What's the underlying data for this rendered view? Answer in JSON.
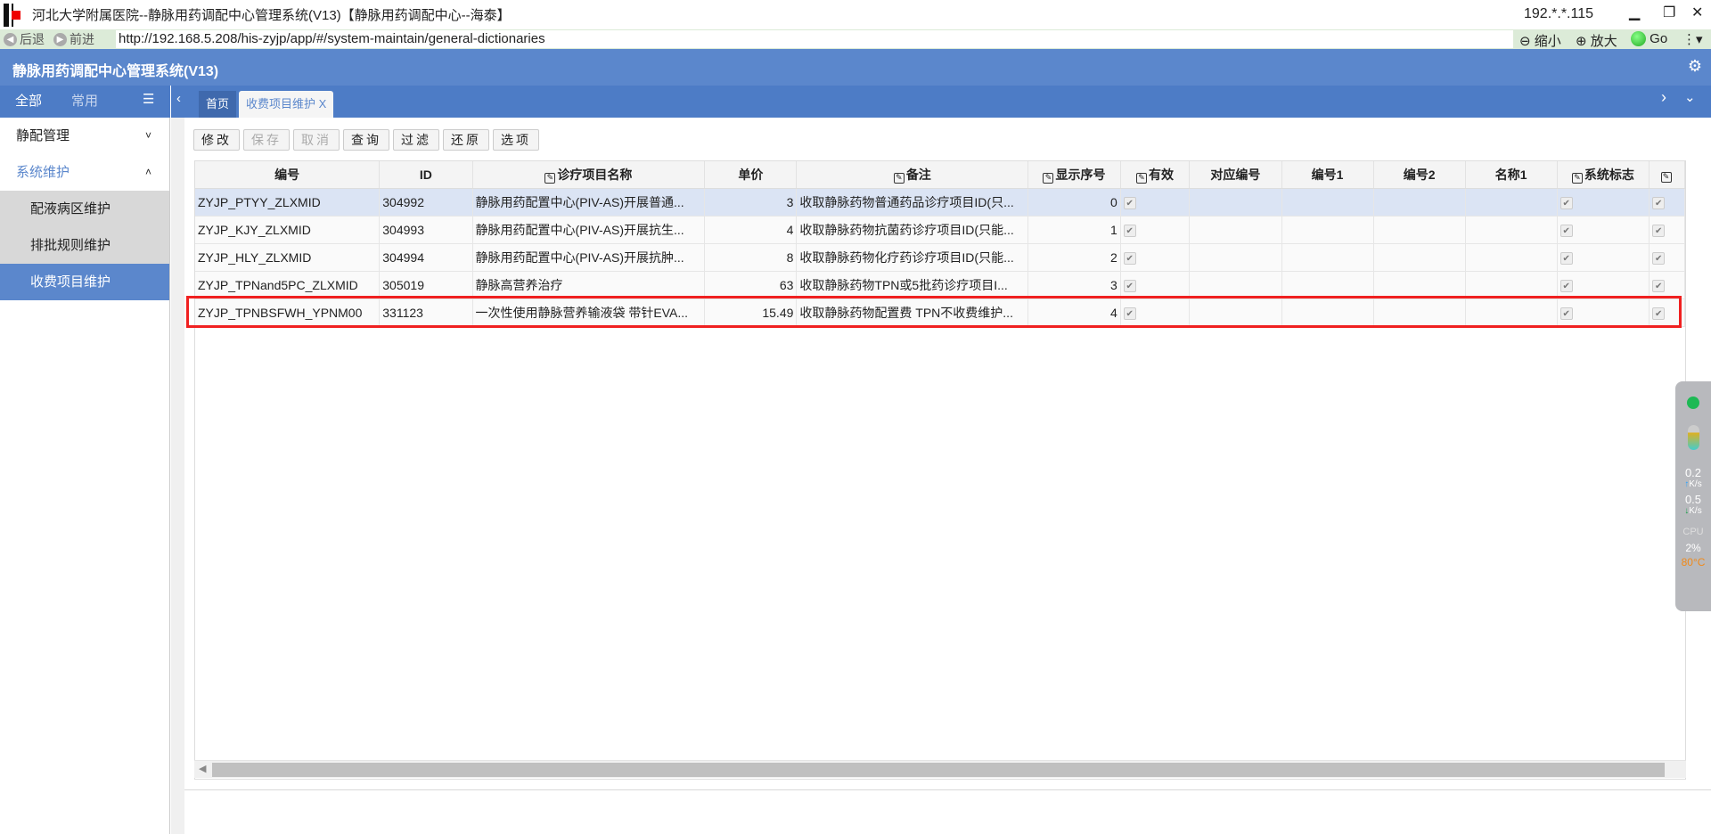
{
  "window": {
    "title": "河北大学附属医院--静脉用药调配中心管理系统(V13)【静脉用药调配中心--海泰】",
    "ip": "192.*.*.115"
  },
  "browser": {
    "back": "后退",
    "forward": "前进",
    "url": "http://192.168.5.208/his-zyjp/app/#/system-maintain/general-dictionaries",
    "zoom_out": "缩小",
    "zoom_in": "放大",
    "go": "Go"
  },
  "app": {
    "title": "静脉用药调配中心管理系统(V13)"
  },
  "sidebar": {
    "tabs": [
      "全部",
      "常用"
    ],
    "items": [
      {
        "label": "静配管理",
        "chev": "˅"
      },
      {
        "label": "系统维护",
        "chev": "˄"
      },
      {
        "label": "配液病区维护"
      },
      {
        "label": "排批规则维护"
      },
      {
        "label": "收费项目维护"
      }
    ]
  },
  "tabs": [
    {
      "label": "首页"
    },
    {
      "label": "收费项目维护",
      "close": "X"
    }
  ],
  "toolbar": [
    "修改",
    "保存",
    "取消",
    "查询",
    "过滤",
    "还原",
    "选项"
  ],
  "table": {
    "columns": [
      "编号",
      "ID",
      "诊疗项目名称",
      "单价",
      "备注",
      "显示序号",
      "有效",
      "对应编号",
      "编号1",
      "编号2",
      "名称1",
      "系统标志",
      ""
    ],
    "rows": [
      [
        "ZYJP_PTYY_ZLXMID",
        "304992",
        "静脉用药配置中心(PIV-AS)开展普通...",
        "3",
        "收取静脉药物普通药品诊疗项目ID(只...",
        "0"
      ],
      [
        "ZYJP_KJY_ZLXMID",
        "304993",
        "静脉用药配置中心(PIV-AS)开展抗生...",
        "4",
        "收取静脉药物抗菌药诊疗项目ID(只能...",
        "1"
      ],
      [
        "ZYJP_HLY_ZLXMID",
        "304994",
        "静脉用药配置中心(PIV-AS)开展抗肿...",
        "8",
        "收取静脉药物化疗药诊疗项目ID(只能...",
        "2"
      ],
      [
        "ZYJP_TPNand5PC_ZLXMID",
        "305019",
        "静脉高营养治疗",
        "63",
        "收取静脉药物TPN或5批药诊疗项目I...",
        "3"
      ],
      [
        "ZYJP_TPNBSFWH_YPNM00",
        "331123",
        "一次性使用静脉营养输液袋 带针EVA...",
        "15.49",
        "收取静脉药物配置费 TPN不收费维护...",
        "4"
      ]
    ]
  },
  "widget": {
    "up": "0.2",
    "down": "0.5",
    "unit": "K/s",
    "cpu_label": "CPU",
    "cpu": "2%",
    "temp": "80°C"
  },
  "colors": {
    "header": "#5b87cc",
    "highlight": "#f02020",
    "selected_row": "#dbe4f4"
  }
}
